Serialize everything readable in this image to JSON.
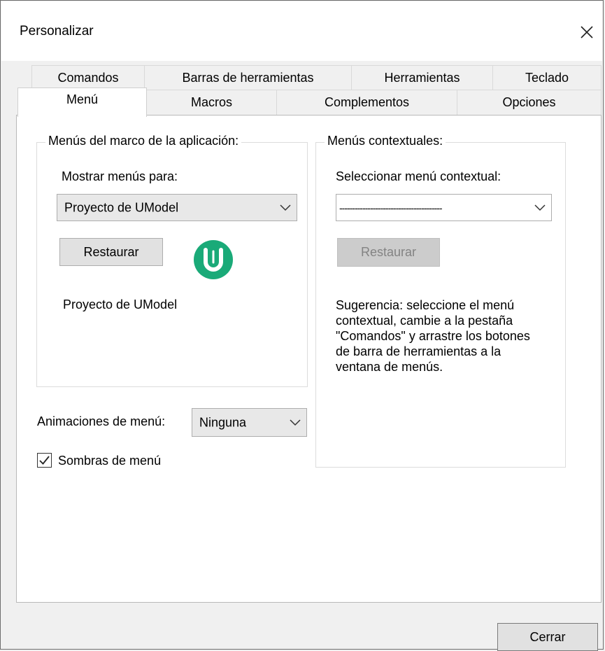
{
  "window": {
    "title": "Personalizar"
  },
  "tabs": {
    "row1": [
      "Comandos",
      "Barras de herramientas",
      "Herramientas",
      "Teclado"
    ],
    "row2": [
      "Menú",
      "Macros",
      "Complementos",
      "Opciones"
    ],
    "active": "Menú"
  },
  "app_menus": {
    "group_label": "Menús del marco de la aplicación:",
    "show_for_label": "Mostrar menús para:",
    "selected": "Proyecto de UModel",
    "restore_label": "Restaurar",
    "current_label": "Proyecto de UModel",
    "logo_icon": "umodel-logo-icon",
    "logo_color": "#1aaa78"
  },
  "context_menus": {
    "group_label": "Menús contextuales:",
    "select_label": "Seleccionar menú contextual:",
    "selected": "----------------------------------------",
    "restore_label": "Restaurar",
    "hint": "Sugerencia: seleccione el menú contextual, cambie a la pestaña \"Comandos\" y arrastre los botones de barra de herramientas a la ventana de menús."
  },
  "animations": {
    "label": "Animaciones de menú:",
    "selected": "Ninguna"
  },
  "shadows": {
    "label": "Sombras de menú",
    "checked": true
  },
  "footer": {
    "close_label": "Cerrar"
  }
}
